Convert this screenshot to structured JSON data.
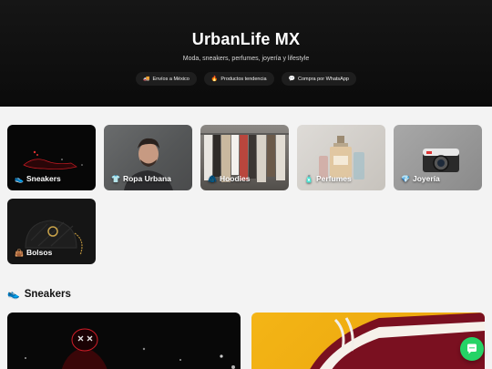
{
  "hero": {
    "title": "UrbanLife MX",
    "tagline": "Moda, sneakers, perfumes, joyería y lifestyle",
    "pills": [
      {
        "icon": "truck-icon",
        "glyph": "🚚",
        "label": "Envíos a México"
      },
      {
        "icon": "fire-icon",
        "glyph": "🔥",
        "label": "Productos tendencia"
      },
      {
        "icon": "chat-bubble-icon",
        "glyph": "💬",
        "label": "Compra por WhatsApp"
      }
    ]
  },
  "categories": [
    {
      "icon": "sneaker-icon",
      "glyph": "👟",
      "label": "Sneakers"
    },
    {
      "icon": "tshirt-icon",
      "glyph": "👕",
      "label": "Ropa Urbana"
    },
    {
      "icon": "hoodie-icon",
      "glyph": "🧥",
      "label": "Hoodies"
    },
    {
      "icon": "perfume-icon",
      "glyph": "🧴",
      "label": "Perfumes"
    },
    {
      "icon": "gem-icon",
      "glyph": "💎",
      "label": "Joyería"
    },
    {
      "icon": "handbag-icon",
      "glyph": "👜",
      "label": "Bolsos"
    }
  ],
  "section": {
    "icon": "sneaker-icon",
    "glyph": "👟",
    "title": "Sneakers"
  },
  "colors": {
    "hero_bg": "#0b0b0b",
    "page_bg": "#f3f3f3",
    "whatsapp": "#25d366",
    "accent_yellow": "#f4b516"
  }
}
